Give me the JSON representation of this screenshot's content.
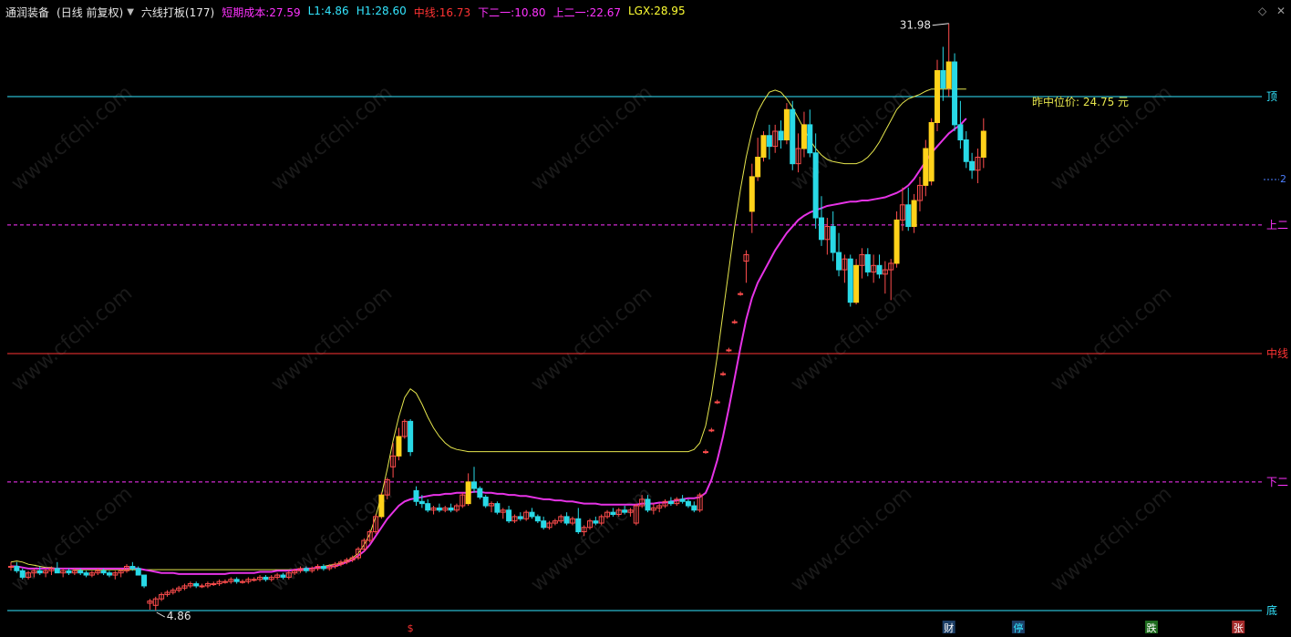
{
  "header": {
    "title": "通润装备",
    "period": "(日线 前复权)",
    "indicator_name": "六线打板(177)",
    "items": [
      {
        "label": "短期成本:",
        "value": "27.59",
        "color": "#ff33ff"
      },
      {
        "label": "L1:",
        "value": "4.86",
        "color": "#33e6ff"
      },
      {
        "label": "H1:",
        "value": "28.60",
        "color": "#33e6ff"
      },
      {
        "label": "中线:",
        "value": "16.73",
        "color": "#ff3333"
      },
      {
        "label": "下二一:",
        "value": "10.80",
        "color": "#ff33ff"
      },
      {
        "label": "上二一:",
        "value": "22.67",
        "color": "#ff33ff"
      },
      {
        "label": "LGX:",
        "value": "28.95",
        "color": "#ffff33"
      }
    ]
  },
  "icons": {
    "menu": "dropdown-icon",
    "settings": "diamond-icon",
    "close": "close-icon"
  },
  "chart_data": {
    "type": "candlestick",
    "ylim": [
      3.5,
      33.5
    ],
    "levels": [
      {
        "name": "顶",
        "value": 28.6,
        "color": "#33e6ff",
        "style": "solid"
      },
      {
        "name": "上二",
        "value": 22.67,
        "color": "#ff33ff",
        "style": "dashed"
      },
      {
        "name": "中线",
        "value": 16.73,
        "color": "#ff3333",
        "style": "solid"
      },
      {
        "name": "下二",
        "value": 10.8,
        "color": "#ff33ff",
        "style": "dashed"
      },
      {
        "name": "底",
        "value": 4.86,
        "color": "#33e6ff",
        "style": "solid"
      }
    ],
    "annotations": {
      "max_label": "31.98",
      "min_label": "4.86",
      "mid_price_label": "昨中位价: 24.75 元",
      "right_edge_label": "2"
    },
    "candles": [
      [
        6.9,
        7.1,
        6.7,
        6.9
      ],
      [
        6.9,
        7.1,
        6.6,
        6.7
      ],
      [
        6.7,
        6.8,
        6.3,
        6.4
      ],
      [
        6.4,
        6.7,
        6.3,
        6.6
      ],
      [
        6.6,
        6.8,
        6.4,
        6.7
      ],
      [
        6.7,
        6.9,
        6.5,
        6.6
      ],
      [
        6.6,
        6.8,
        6.4,
        6.7
      ],
      [
        6.7,
        6.9,
        6.5,
        6.8
      ],
      [
        6.8,
        7.1,
        6.6,
        6.6
      ],
      [
        6.6,
        6.8,
        6.4,
        6.7
      ],
      [
        6.7,
        6.8,
        6.5,
        6.6
      ],
      [
        6.6,
        6.8,
        6.5,
        6.7
      ],
      [
        6.7,
        6.8,
        6.5,
        6.6
      ],
      [
        6.6,
        6.7,
        6.4,
        6.5
      ],
      [
        6.5,
        6.7,
        6.4,
        6.6
      ],
      [
        6.6,
        6.8,
        6.5,
        6.7
      ],
      [
        6.7,
        6.8,
        6.5,
        6.6
      ],
      [
        6.6,
        6.7,
        6.4,
        6.5
      ],
      [
        6.5,
        6.7,
        6.3,
        6.6
      ],
      [
        6.6,
        6.8,
        6.4,
        6.7
      ],
      [
        6.7,
        7.0,
        6.6,
        6.9
      ],
      [
        6.9,
        7.1,
        6.7,
        6.8
      ],
      [
        6.8,
        6.9,
        6.5,
        6.5
      ],
      [
        6.5,
        6.5,
        5.9,
        6.0
      ],
      [
        5.2,
        5.4,
        4.9,
        5.3
      ],
      [
        5.1,
        5.5,
        4.86,
        5.4
      ],
      [
        5.4,
        5.7,
        5.3,
        5.6
      ],
      [
        5.6,
        5.8,
        5.5,
        5.7
      ],
      [
        5.7,
        5.9,
        5.6,
        5.8
      ],
      [
        5.8,
        6.0,
        5.7,
        5.9
      ],
      [
        5.9,
        6.1,
        5.8,
        6.0
      ],
      [
        6.0,
        6.2,
        5.9,
        6.1
      ],
      [
        6.1,
        6.2,
        5.9,
        6.0
      ],
      [
        6.0,
        6.1,
        5.9,
        6.0
      ],
      [
        6.0,
        6.2,
        5.9,
        6.1
      ],
      [
        6.1,
        6.2,
        6.0,
        6.1
      ],
      [
        6.1,
        6.3,
        6.0,
        6.2
      ],
      [
        6.2,
        6.3,
        6.1,
        6.2
      ],
      [
        6.2,
        6.4,
        6.1,
        6.3
      ],
      [
        6.3,
        6.4,
        6.1,
        6.2
      ],
      [
        6.2,
        6.3,
        6.1,
        6.2
      ],
      [
        6.2,
        6.4,
        6.1,
        6.3
      ],
      [
        6.3,
        6.4,
        6.2,
        6.3
      ],
      [
        6.3,
        6.5,
        6.2,
        6.4
      ],
      [
        6.4,
        6.5,
        6.2,
        6.3
      ],
      [
        6.3,
        6.5,
        6.2,
        6.4
      ],
      [
        6.4,
        6.6,
        6.3,
        6.5
      ],
      [
        6.5,
        6.6,
        6.3,
        6.4
      ],
      [
        6.4,
        6.7,
        6.3,
        6.6
      ],
      [
        6.6,
        6.8,
        6.5,
        6.7
      ],
      [
        6.7,
        6.9,
        6.6,
        6.8
      ],
      [
        6.8,
        6.9,
        6.6,
        6.7
      ],
      [
        6.7,
        6.9,
        6.6,
        6.8
      ],
      [
        6.8,
        7.0,
        6.7,
        6.9
      ],
      [
        6.9,
        7.0,
        6.7,
        6.8
      ],
      [
        6.8,
        7.0,
        6.7,
        6.9
      ],
      [
        6.9,
        7.1,
        6.8,
        7.0
      ],
      [
        7.0,
        7.2,
        6.9,
        7.1
      ],
      [
        7.1,
        7.3,
        7.0,
        7.2
      ],
      [
        7.2,
        7.4,
        7.1,
        7.3
      ],
      [
        7.3,
        7.8,
        7.2,
        7.7
      ],
      [
        7.7,
        8.2,
        7.6,
        8.1
      ],
      [
        8.1,
        8.6,
        8.0,
        8.5
      ],
      [
        8.5,
        9.3,
        8.4,
        9.2
      ],
      [
        9.2,
        10.3,
        9.1,
        10.2
      ],
      [
        10.2,
        11.0,
        10.0,
        10.9
      ],
      [
        11.5,
        12.6,
        11.0,
        12.0
      ],
      [
        12.0,
        13.3,
        11.8,
        12.9
      ],
      [
        12.9,
        13.7,
        12.8,
        13.6
      ],
      [
        13.6,
        13.7,
        12.0,
        12.2
      ],
      [
        10.4,
        10.6,
        9.7,
        9.9
      ],
      [
        9.9,
        10.2,
        9.6,
        9.8
      ],
      [
        9.8,
        10.0,
        9.4,
        9.5
      ],
      [
        9.5,
        9.7,
        9.3,
        9.6
      ],
      [
        9.6,
        9.8,
        9.4,
        9.5
      ],
      [
        9.5,
        9.7,
        9.4,
        9.6
      ],
      [
        9.6,
        9.8,
        9.4,
        9.5
      ],
      [
        9.5,
        9.8,
        9.4,
        9.7
      ],
      [
        9.7,
        10.3,
        9.6,
        10.2
      ],
      [
        9.8,
        11.2,
        9.7,
        10.8
      ],
      [
        10.8,
        11.5,
        10.3,
        10.5
      ],
      [
        10.5,
        10.6,
        10.0,
        10.1
      ],
      [
        10.1,
        10.2,
        9.6,
        9.7
      ],
      [
        9.7,
        9.9,
        9.4,
        9.8
      ],
      [
        9.8,
        9.9,
        9.3,
        9.4
      ],
      [
        9.4,
        9.6,
        9.1,
        9.5
      ],
      [
        9.5,
        9.7,
        8.9,
        9.0
      ],
      [
        9.0,
        9.3,
        8.9,
        9.2
      ],
      [
        9.2,
        9.4,
        9.0,
        9.1
      ],
      [
        9.1,
        9.5,
        9.0,
        9.4
      ],
      [
        9.4,
        9.6,
        9.1,
        9.2
      ],
      [
        9.2,
        9.3,
        8.9,
        9.0
      ],
      [
        9.0,
        9.2,
        8.6,
        8.7
      ],
      [
        8.7,
        9.0,
        8.6,
        8.9
      ],
      [
        8.9,
        9.1,
        8.8,
        9.0
      ],
      [
        9.0,
        9.3,
        8.9,
        9.2
      ],
      [
        9.2,
        9.4,
        8.8,
        8.9
      ],
      [
        8.9,
        9.2,
        8.8,
        9.1
      ],
      [
        9.1,
        9.6,
        8.4,
        8.5
      ],
      [
        8.5,
        8.8,
        8.3,
        8.7
      ],
      [
        8.7,
        9.1,
        8.6,
        9.0
      ],
      [
        9.0,
        9.2,
        8.8,
        8.9
      ],
      [
        8.9,
        9.3,
        8.8,
        9.2
      ],
      [
        9.2,
        9.5,
        9.1,
        9.4
      ],
      [
        9.4,
        9.6,
        9.2,
        9.3
      ],
      [
        9.3,
        9.6,
        9.2,
        9.5
      ],
      [
        9.5,
        9.7,
        9.3,
        9.4
      ],
      [
        9.4,
        9.6,
        9.2,
        9.5
      ],
      [
        8.9,
        9.8,
        8.8,
        9.7
      ],
      [
        9.7,
        10.2,
        9.6,
        10.0
      ],
      [
        10.0,
        10.2,
        9.4,
        9.5
      ],
      [
        9.5,
        9.8,
        9.3,
        9.6
      ],
      [
        9.6,
        9.8,
        9.4,
        9.7
      ],
      [
        9.7,
        10.0,
        9.6,
        9.9
      ],
      [
        9.9,
        10.1,
        9.7,
        9.8
      ],
      [
        9.8,
        10.1,
        9.7,
        10.0
      ],
      [
        10.0,
        10.2,
        9.8,
        9.9
      ],
      [
        9.9,
        10.0,
        9.6,
        9.7
      ],
      [
        9.7,
        9.9,
        9.4,
        9.5
      ],
      [
        9.5,
        10.3,
        9.4,
        10.2
      ],
      [
        12.2,
        12.3,
        12.1,
        12.2
      ],
      [
        13.2,
        13.3,
        13.1,
        13.2
      ],
      [
        14.5,
        14.6,
        14.4,
        14.5
      ],
      [
        15.8,
        15.9,
        15.7,
        15.8
      ],
      [
        16.9,
        17.0,
        16.8,
        16.9
      ],
      [
        18.2,
        18.3,
        18.1,
        18.2
      ],
      [
        19.5,
        19.6,
        19.4,
        19.5
      ],
      [
        21.0,
        21.5,
        20.0,
        21.3
      ],
      [
        23.3,
        25.5,
        22.3,
        24.9
      ],
      [
        24.9,
        26.7,
        24.7,
        25.8
      ],
      [
        25.8,
        27.0,
        25.6,
        26.8
      ],
      [
        26.8,
        27.3,
        25.7,
        26.3
      ],
      [
        26.3,
        27.3,
        26.0,
        27.0
      ],
      [
        27.0,
        27.5,
        26.2,
        26.6
      ],
      [
        26.6,
        28.3,
        26.4,
        28.0
      ],
      [
        28.0,
        28.4,
        25.2,
        25.5
      ],
      [
        25.5,
        26.9,
        25.1,
        26.2
      ],
      [
        26.2,
        27.9,
        25.8,
        27.3
      ],
      [
        27.3,
        28.0,
        25.8,
        26.0
      ],
      [
        26.0,
        26.9,
        22.5,
        23.0
      ],
      [
        23.0,
        24.0,
        21.7,
        22.0
      ],
      [
        22.0,
        23.0,
        21.3,
        22.6
      ],
      [
        22.6,
        23.3,
        21.0,
        21.4
      ],
      [
        21.4,
        22.3,
        20.3,
        20.6
      ],
      [
        20.6,
        21.3,
        20.0,
        21.1
      ],
      [
        21.1,
        21.3,
        18.9,
        19.1
      ],
      [
        19.1,
        21.1,
        19.0,
        20.8
      ],
      [
        20.8,
        21.6,
        20.2,
        21.3
      ],
      [
        21.3,
        21.6,
        20.3,
        20.5
      ],
      [
        20.5,
        21.3,
        20.0,
        20.8
      ],
      [
        20.8,
        21.3,
        20.2,
        20.4
      ],
      [
        20.4,
        21.0,
        19.5,
        20.6
      ],
      [
        20.6,
        21.1,
        19.2,
        20.9
      ],
      [
        20.9,
        23.3,
        20.7,
        22.9
      ],
      [
        22.9,
        24.4,
        22.4,
        23.6
      ],
      [
        23.6,
        24.4,
        22.4,
        22.6
      ],
      [
        22.6,
        24.1,
        22.3,
        23.8
      ],
      [
        23.8,
        24.9,
        23.3,
        24.5
      ],
      [
        24.5,
        26.6,
        24.0,
        26.2
      ],
      [
        24.7,
        27.6,
        24.5,
        27.4
      ],
      [
        27.4,
        30.3,
        27.0,
        29.8
      ],
      [
        29.8,
        30.9,
        28.4,
        29.0
      ],
      [
        29.0,
        31.98,
        28.6,
        30.2
      ],
      [
        30.2,
        30.6,
        27.0,
        27.3
      ],
      [
        27.3,
        28.4,
        26.2,
        26.6
      ],
      [
        26.6,
        27.0,
        25.3,
        25.6
      ],
      [
        25.6,
        26.0,
        24.8,
        25.2
      ],
      [
        25.2,
        26.2,
        24.6,
        25.8
      ],
      [
        25.8,
        27.6,
        25.3,
        27.0
      ]
    ],
    "cost_line": [
      6.9,
      6.9,
      6.85,
      6.8,
      6.8,
      6.8,
      6.8,
      6.8,
      6.8,
      6.8,
      6.8,
      6.8,
      6.8,
      6.8,
      6.8,
      6.8,
      6.8,
      6.8,
      6.8,
      6.8,
      6.8,
      6.82,
      6.8,
      6.75,
      6.7,
      6.65,
      6.6,
      6.6,
      6.6,
      6.55,
      6.55,
      6.55,
      6.55,
      6.55,
      6.55,
      6.55,
      6.55,
      6.55,
      6.6,
      6.6,
      6.6,
      6.6,
      6.6,
      6.65,
      6.65,
      6.65,
      6.7,
      6.7,
      6.7,
      6.75,
      6.75,
      6.8,
      6.8,
      6.85,
      6.85,
      6.9,
      6.9,
      7.0,
      7.1,
      7.2,
      7.4,
      7.6,
      7.9,
      8.3,
      8.7,
      9.1,
      9.4,
      9.7,
      9.9,
      10.0,
      10.05,
      10.1,
      10.15,
      10.2,
      10.2,
      10.25,
      10.25,
      10.3,
      10.3,
      10.3,
      10.35,
      10.35,
      10.3,
      10.3,
      10.25,
      10.25,
      10.2,
      10.2,
      10.15,
      10.15,
      10.1,
      10.05,
      10.0,
      10.0,
      9.95,
      9.95,
      9.9,
      9.9,
      9.85,
      9.8,
      9.8,
      9.8,
      9.75,
      9.75,
      9.75,
      9.75,
      9.75,
      9.75,
      9.75,
      9.8,
      9.8,
      9.8,
      9.85,
      9.85,
      9.9,
      9.95,
      10.0,
      10.05,
      10.05,
      10.1,
      10.3,
      10.9,
      11.8,
      12.9,
      14.2,
      15.6,
      17.0,
      18.3,
      19.3,
      20.0,
      20.5,
      21.0,
      21.5,
      21.9,
      22.3,
      22.6,
      22.9,
      23.1,
      23.25,
      23.35,
      23.45,
      23.55,
      23.6,
      23.65,
      23.7,
      23.75,
      23.75,
      23.8,
      23.8,
      23.85,
      23.9,
      23.95,
      24.05,
      24.15,
      24.3,
      24.5,
      24.8,
      25.2,
      25.6,
      26.0,
      26.3,
      26.6,
      26.9,
      27.1,
      27.3,
      27.59
    ],
    "lgx_line": [
      7.1,
      7.15,
      7.1,
      7.0,
      6.95,
      6.9,
      6.85,
      6.85,
      6.8,
      6.8,
      6.8,
      6.75,
      6.75,
      6.75,
      6.75,
      6.75,
      6.75,
      6.75,
      6.75,
      6.75,
      6.75,
      6.75,
      6.75,
      6.75,
      6.75,
      6.75,
      6.75,
      6.75,
      6.75,
      6.75,
      6.75,
      6.75,
      6.75,
      6.75,
      6.75,
      6.75,
      6.75,
      6.75,
      6.75,
      6.75,
      6.75,
      6.75,
      6.75,
      6.75,
      6.75,
      6.75,
      6.75,
      6.75,
      6.75,
      6.75,
      6.8,
      6.8,
      6.8,
      6.85,
      6.9,
      6.95,
      7.0,
      7.05,
      7.15,
      7.3,
      7.5,
      7.9,
      8.4,
      9.2,
      10.2,
      11.4,
      12.7,
      13.8,
      14.7,
      15.1,
      14.9,
      14.4,
      13.8,
      13.3,
      12.9,
      12.6,
      12.4,
      12.3,
      12.25,
      12.2,
      12.2,
      12.2,
      12.2,
      12.2,
      12.2,
      12.2,
      12.2,
      12.2,
      12.2,
      12.2,
      12.2,
      12.2,
      12.2,
      12.2,
      12.2,
      12.2,
      12.2,
      12.2,
      12.2,
      12.2,
      12.2,
      12.2,
      12.2,
      12.2,
      12.2,
      12.2,
      12.2,
      12.2,
      12.2,
      12.2,
      12.2,
      12.2,
      12.2,
      12.2,
      12.2,
      12.2,
      12.2,
      12.2,
      12.3,
      12.6,
      13.4,
      14.8,
      16.6,
      18.6,
      20.6,
      22.6,
      24.3,
      25.8,
      27.0,
      27.9,
      28.4,
      28.8,
      28.9,
      28.8,
      28.5,
      28.1,
      27.6,
      27.1,
      26.6,
      26.2,
      25.9,
      25.7,
      25.6,
      25.55,
      25.5,
      25.5,
      25.5,
      25.6,
      25.8,
      26.1,
      26.5,
      27.0,
      27.5,
      28.0,
      28.3,
      28.5,
      28.6,
      28.7,
      28.85,
      28.95,
      28.95,
      28.95,
      28.95,
      28.95,
      28.95,
      28.95
    ],
    "bottom_markers": [
      {
        "index": 69,
        "text": "$",
        "color": "#ff3333",
        "bg": ""
      },
      {
        "index": 162,
        "text": "财",
        "color": "#ffffff",
        "bg": "#1c3e66"
      },
      {
        "index": 174,
        "text": "停",
        "color": "#33e6ff",
        "bg": "#1c3e66"
      },
      {
        "index": 197,
        "text": "跌",
        "color": "#ffffff",
        "bg": "#1e6b1e"
      },
      {
        "index": 212,
        "text": "张",
        "color": "#ffffff",
        "bg": "#a32a2a"
      }
    ],
    "watermark": "www.cfchi.com"
  }
}
